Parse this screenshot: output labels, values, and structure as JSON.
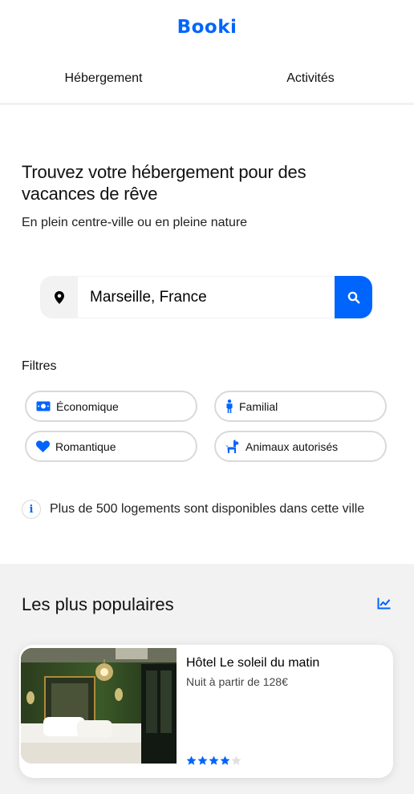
{
  "brand": {
    "logo": "Booki",
    "color": "#0065fc"
  },
  "nav": {
    "tabs": [
      {
        "label": "Hébergement"
      },
      {
        "label": "Activités"
      }
    ]
  },
  "hero": {
    "title_line1": "Trouvez votre hébergement pour des",
    "title_line2": "vacances de rêve",
    "subtitle": "En plein centre-ville ou en pleine nature"
  },
  "search": {
    "value": "Marseille, France",
    "location_icon": "map-pin-icon",
    "button_icon": "search-icon"
  },
  "filters": {
    "title": "Filtres",
    "items": [
      {
        "label": "Économique",
        "icon": "money-icon"
      },
      {
        "label": "Familial",
        "icon": "person-icon"
      },
      {
        "label": "Romantique",
        "icon": "heart-icon"
      },
      {
        "label": "Animaux autorisés",
        "icon": "dog-icon"
      }
    ]
  },
  "info": {
    "text": "Plus de 500 logements sont disponibles dans cette ville",
    "icon": "info-icon"
  },
  "popular": {
    "title": "Les plus populaires",
    "icon": "trend-chart-icon",
    "cards": [
      {
        "name": "Hôtel Le soleil du matin",
        "price": "Nuit à partir de 128€",
        "rating": 4,
        "max_rating": 5
      }
    ]
  }
}
